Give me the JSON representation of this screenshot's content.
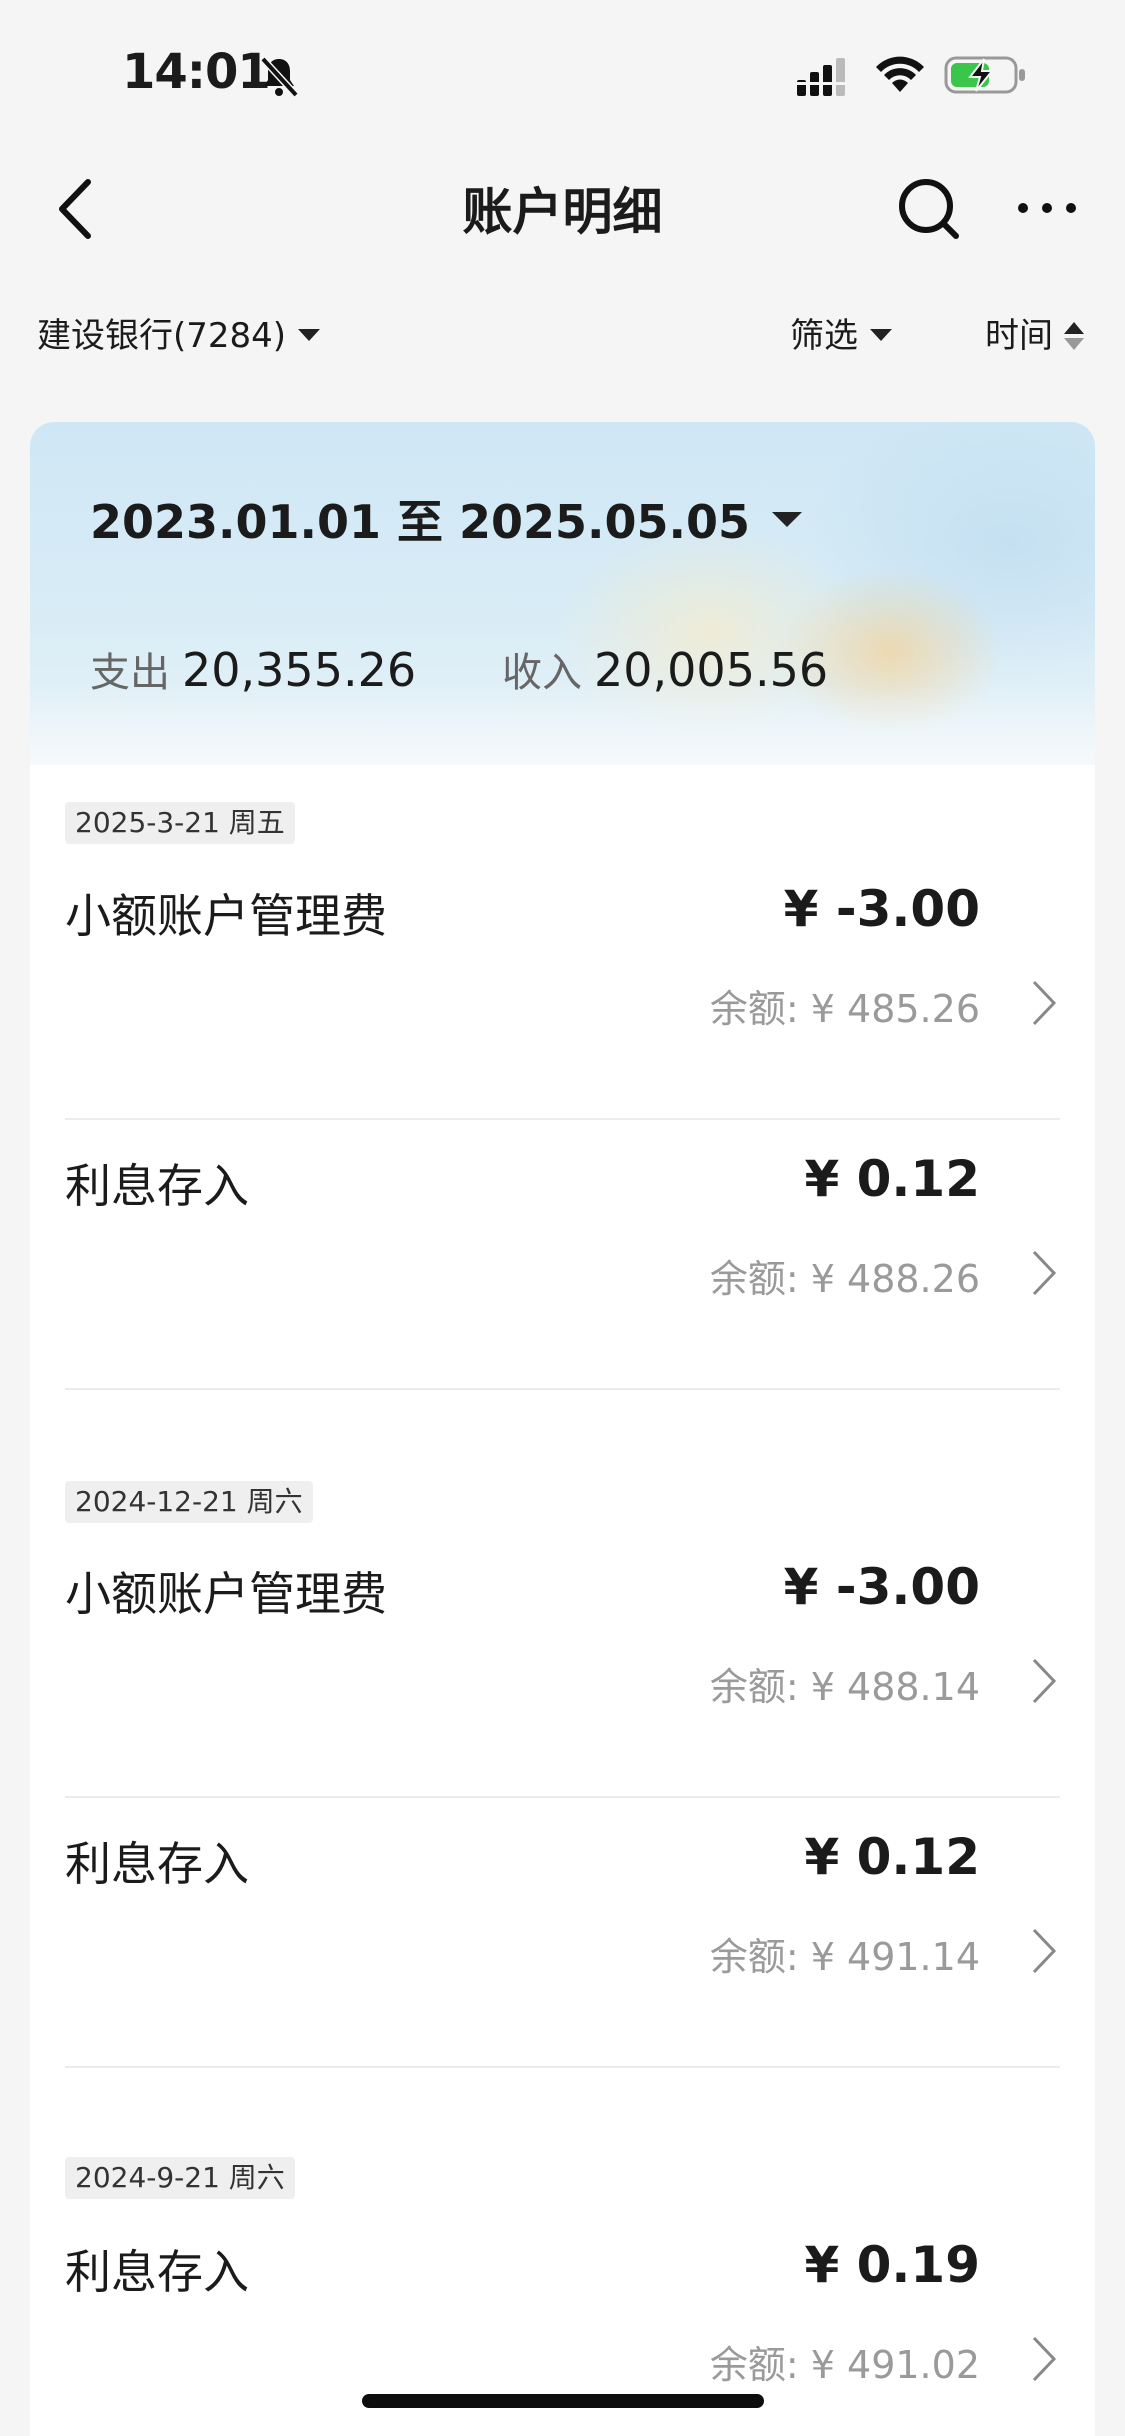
{
  "status_bar": {
    "time": "14:01"
  },
  "nav": {
    "title": "账户明细"
  },
  "filters": {
    "account": "建设银行(7284)",
    "filter": "筛选",
    "sort": "时间"
  },
  "summary": {
    "date_range": "2023.01.01 至 2025.05.05",
    "expense_label": "支出",
    "expense_value": "20,355.26",
    "income_label": "收入",
    "income_value": "20,005.56"
  },
  "groups": [
    {
      "date": "2025-3-21 周五",
      "items": [
        {
          "title": "小额账户管理费",
          "amount": "¥ -3.00",
          "balance": "余额: ¥ 485.26"
        },
        {
          "title": "利息存入",
          "amount": "¥ 0.12",
          "balance": "余额: ¥ 488.26"
        }
      ]
    },
    {
      "date": "2024-12-21 周六",
      "items": [
        {
          "title": "小额账户管理费",
          "amount": "¥ -3.00",
          "balance": "余额: ¥ 488.14"
        },
        {
          "title": "利息存入",
          "amount": "¥ 0.12",
          "balance": "余额: ¥ 491.14"
        }
      ]
    },
    {
      "date": "2024-9-21 周六",
      "items": [
        {
          "title": "利息存入",
          "amount": "¥ 0.19",
          "balance": "余额: ¥ 491.02"
        }
      ]
    }
  ]
}
